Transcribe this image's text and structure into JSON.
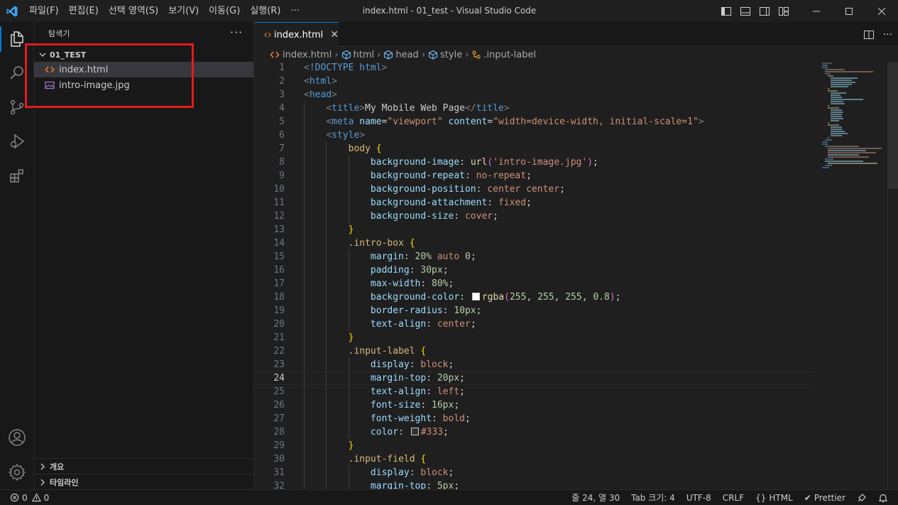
{
  "window": {
    "title": "index.html - 01_test - Visual Studio Code",
    "menu": [
      "파일(F)",
      "편집(E)",
      "선택 영역(S)",
      "보기(V)",
      "이동(G)",
      "실행(R)",
      "···"
    ]
  },
  "activity_bar": {
    "icons": [
      "explorer-icon",
      "search-icon",
      "source-control-icon",
      "run-debug-icon",
      "extensions-icon"
    ],
    "bottom_icons": [
      "account-icon",
      "manage-gear-icon"
    ]
  },
  "sidebar": {
    "header": "탐색기",
    "more": "···",
    "folder": "01_TEST",
    "files": [
      {
        "name": "index.html",
        "icon": "html-file-icon",
        "selected": true
      },
      {
        "name": "intro-image.jpg",
        "icon": "image-file-icon",
        "selected": false
      }
    ],
    "sections": [
      "개요",
      "타임라인"
    ]
  },
  "editor": {
    "tab_label": "index.html",
    "breadcrumb": [
      "index.html",
      "html",
      "head",
      "style",
      ".input-label"
    ],
    "current_line": 24,
    "swatch_colors": {
      "white_rgba": "#ffffff",
      "text_333": "#333333"
    }
  },
  "statusbar": {
    "errors": "0",
    "warnings": "0",
    "position": "줄 24, 열 30",
    "tab_size": "Tab 크기: 4",
    "encoding": "UTF-8",
    "eol": "CRLF",
    "language": "HTML",
    "formatter": "Prettier"
  },
  "code_lines": [
    "<!DOCTYPE html>",
    "<html>",
    "<head>",
    "    <title>My Mobile Web Page</title>",
    "    <meta name=\"viewport\" content=\"width=device-width, initial-scale=1\">",
    "    <style>",
    "        body {",
    "            background-image: url('intro-image.jpg');",
    "            background-repeat: no-repeat;",
    "            background-position: center center;",
    "            background-attachment: fixed;",
    "            background-size: cover;",
    "        }",
    "        .intro-box {",
    "            margin: 20% auto 0;",
    "            padding: 30px;",
    "            max-width: 80%;",
    "            background-color: rgba(255, 255, 255, 0.8);",
    "            border-radius: 10px;",
    "            text-align: center;",
    "        }",
    "        .input-label {",
    "            display: block;",
    "            margin-top: 20px;",
    "            text-align: left;",
    "            font-size: 16px;",
    "            font-weight: bold;",
    "            color: #333;",
    "        }",
    "        .input-field {",
    "            display: block;",
    "            margin-top: 5px;"
  ]
}
